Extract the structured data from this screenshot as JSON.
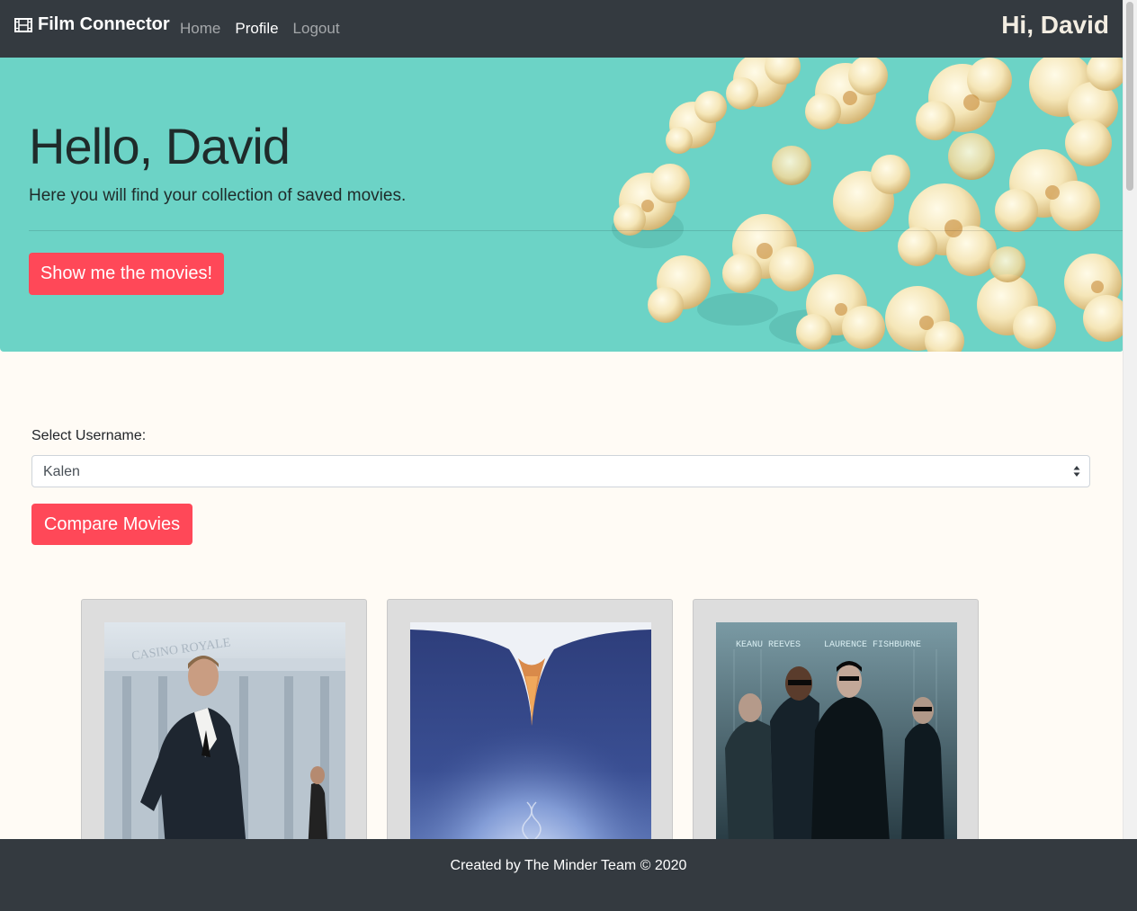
{
  "navbar": {
    "brand": "Film Connector",
    "brand_icon": "film-icon",
    "links": [
      "Home",
      "Profile",
      "Logout"
    ],
    "active_link": "Profile",
    "greeting": "Hi, David"
  },
  "jumbotron": {
    "title": "Hello, David",
    "lead": "Here you will find your collection of saved movies.",
    "button": "Show me the movies!",
    "background_color": "#6cd3c6"
  },
  "form": {
    "label": "Select Username:",
    "selected": "Kalen",
    "button": "Compare Movies"
  },
  "movies": [
    {
      "poster": "casino-royale-poster",
      "poster_text": "CASINO ROYALE"
    },
    {
      "poster": "blue-abstract-poster"
    },
    {
      "poster": "the-matrix-poster",
      "poster_text": [
        "KEANU REEVES",
        "LAURENCE FISHBURNE"
      ]
    }
  ],
  "footer": {
    "text": "Created by The Minder Team © 2020"
  },
  "colors": {
    "navbar": "#343a40",
    "accent": "#ff4858",
    "page_background": "#fffbf5"
  }
}
